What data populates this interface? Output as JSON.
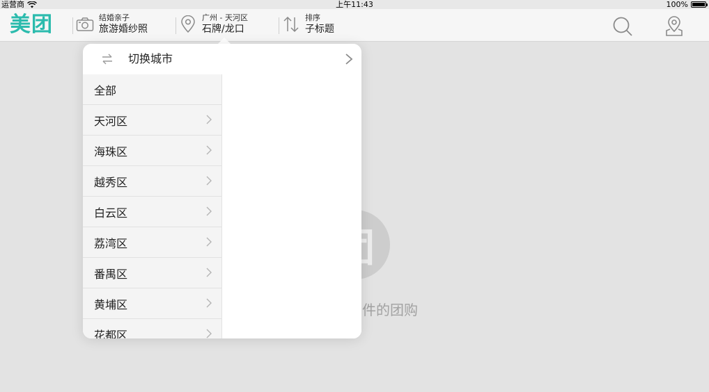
{
  "status_bar": {
    "carrier": "运营商",
    "time": "上午11:43",
    "battery": "100%"
  },
  "header": {
    "brand": "美团",
    "category": {
      "sub": "结婚亲子",
      "main": "旅游婚纱照",
      "icon": "camera-icon"
    },
    "location": {
      "sub": "广州 - 天河区",
      "main": "石牌/龙口",
      "icon": "location-pin-icon"
    },
    "sort": {
      "sub": "排序",
      "main": "子标题",
      "icon": "sort-arrows-icon"
    },
    "search_icon": "search-icon",
    "map_icon": "map-location-icon"
  },
  "background": {
    "empty_badge": "团",
    "empty_text": "件的团购"
  },
  "popover": {
    "switch_city_label": "切换城市",
    "districts": [
      {
        "label": "全部",
        "has_arrow": false
      },
      {
        "label": "天河区",
        "has_arrow": true
      },
      {
        "label": "海珠区",
        "has_arrow": true
      },
      {
        "label": "越秀区",
        "has_arrow": true
      },
      {
        "label": "白云区",
        "has_arrow": true
      },
      {
        "label": "荔湾区",
        "has_arrow": true
      },
      {
        "label": "番禺区",
        "has_arrow": true
      },
      {
        "label": "黄埔区",
        "has_arrow": true
      },
      {
        "label": "花都区",
        "has_arrow": true
      }
    ]
  },
  "colors": {
    "brand": "#2bbbad"
  }
}
